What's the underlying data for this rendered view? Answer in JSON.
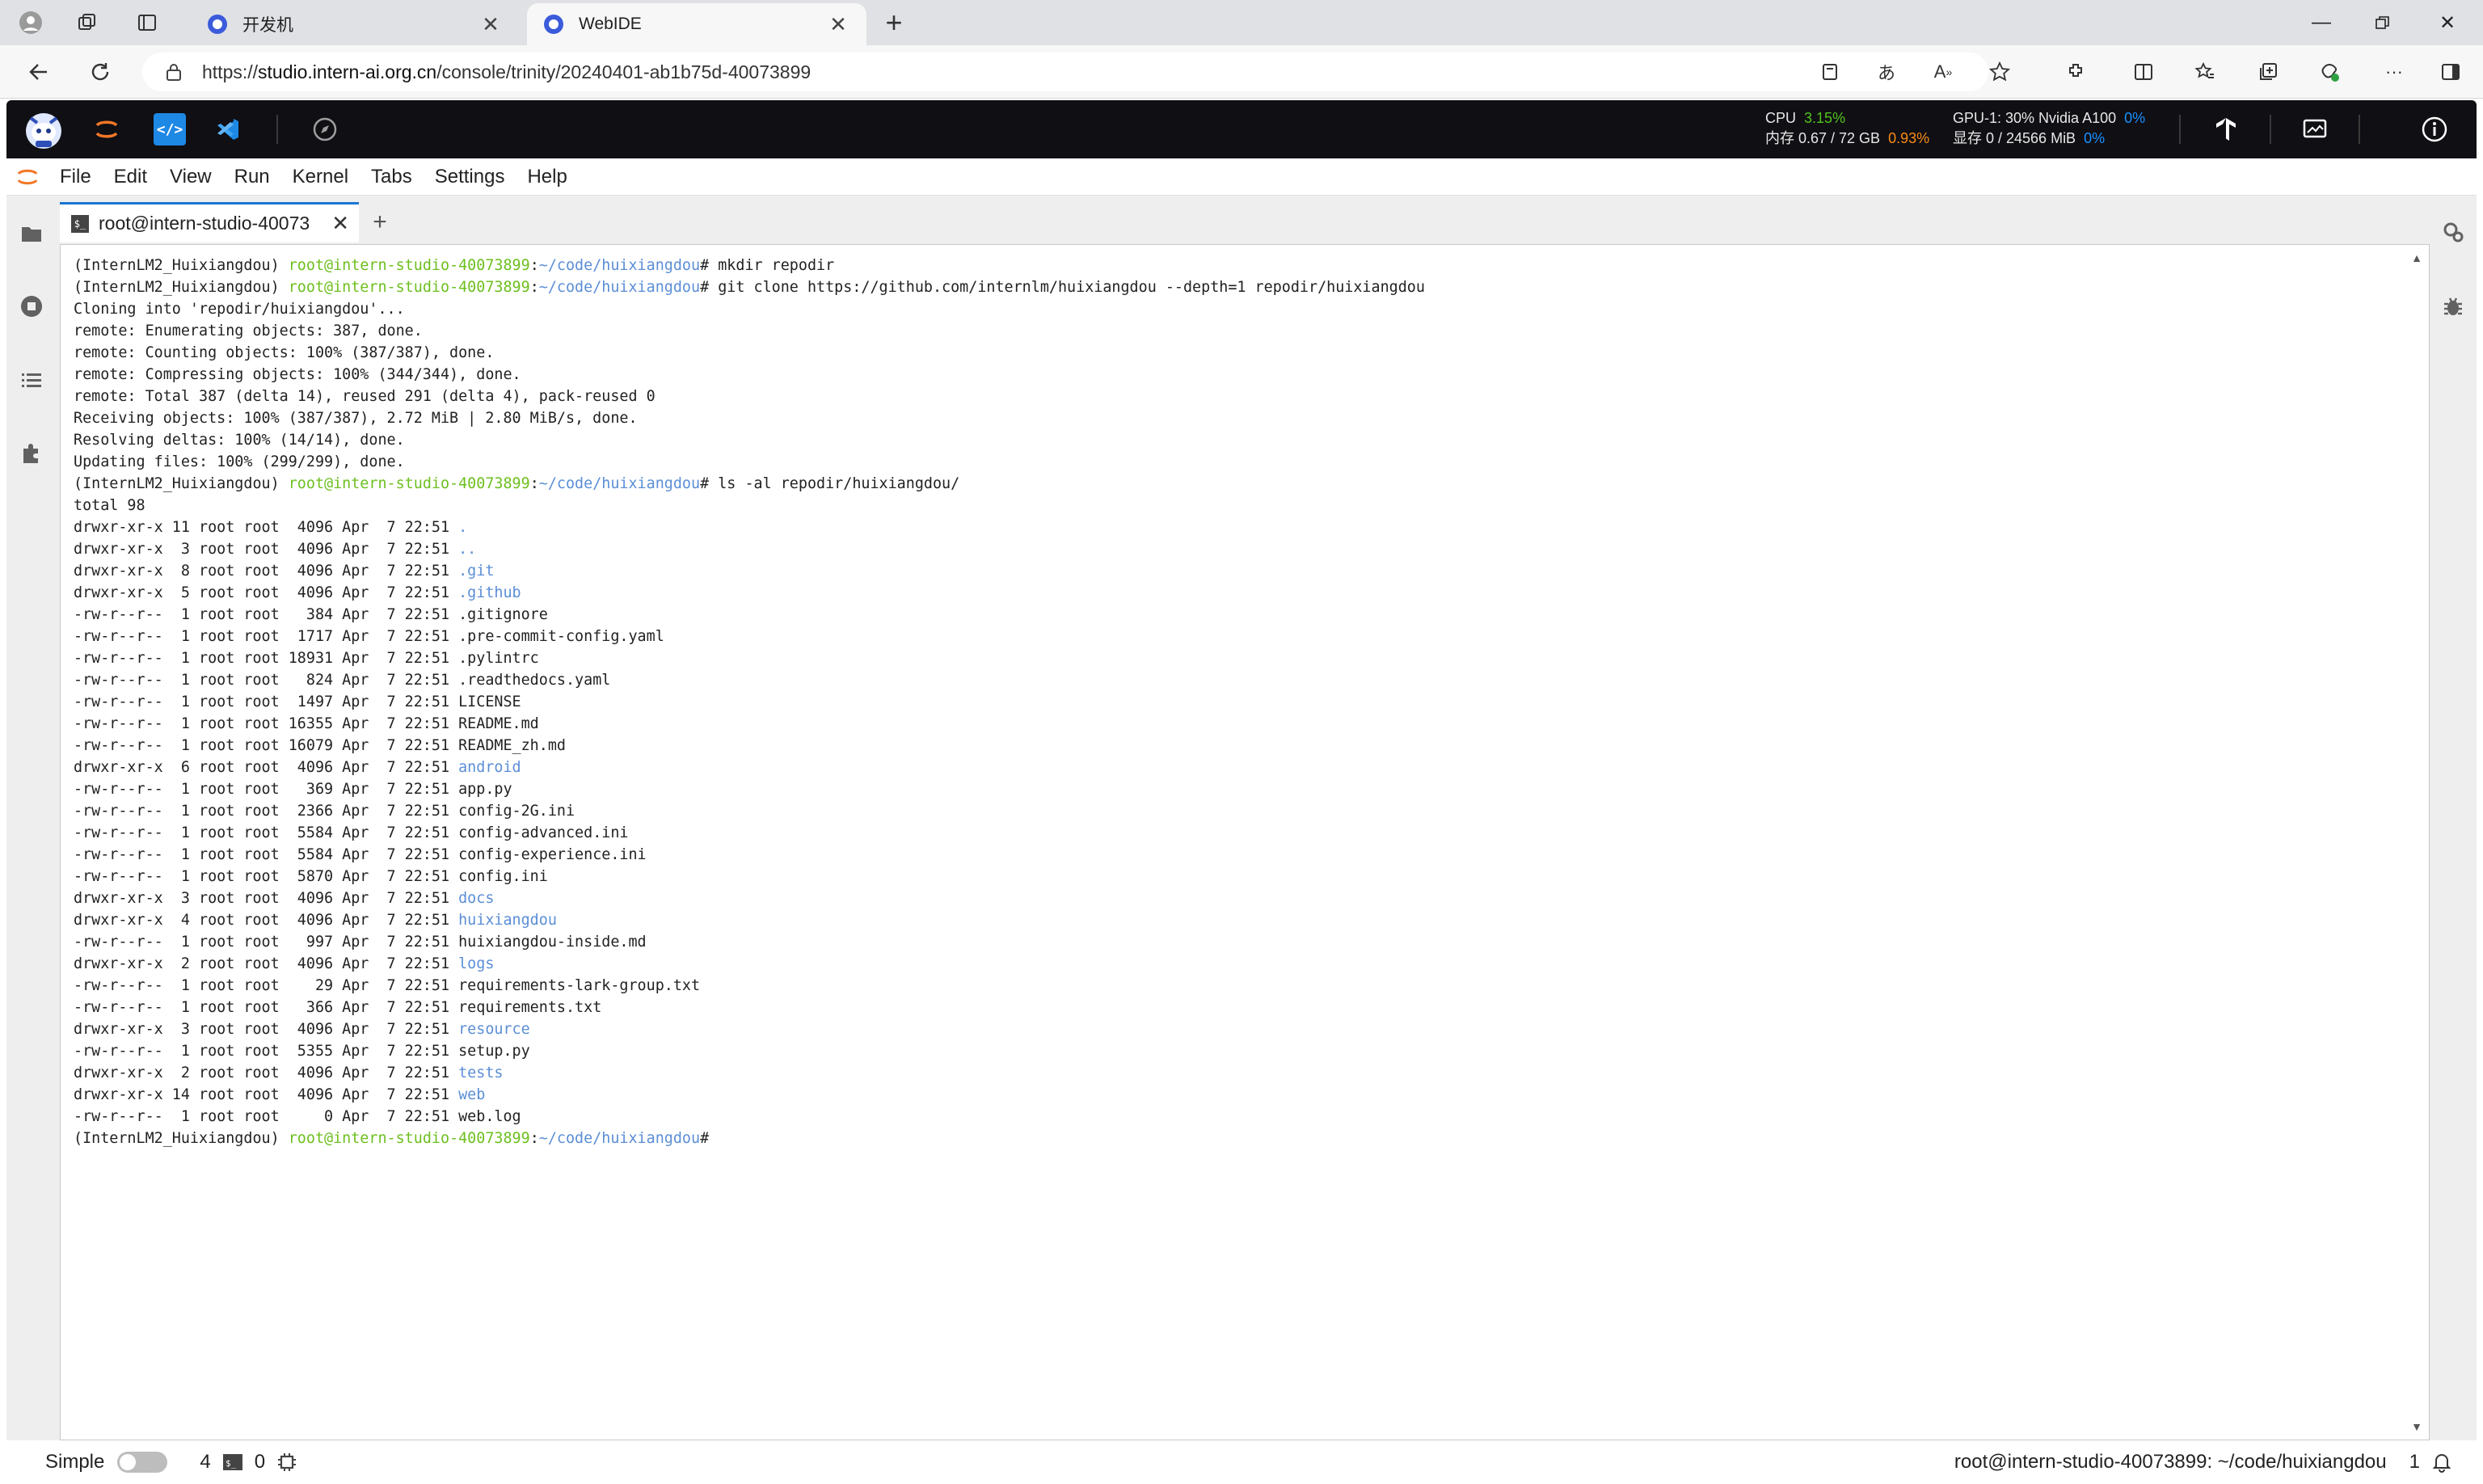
{
  "browser": {
    "tabs": [
      {
        "title": "开发机",
        "active": false
      },
      {
        "title": "WebIDE",
        "active": true
      }
    ],
    "url_prefix": "https://",
    "url_host": "studio.intern-ai.org.cn",
    "url_path": "/console/trinity/20240401-ab1b75d-40073899"
  },
  "ide": {
    "cpu_label": "CPU",
    "cpu_value": "3.15%",
    "mem_label": "内存 0.67 / 72 GB",
    "mem_value": "0.93%",
    "gpu_label": "GPU-1: 30% Nvidia A100",
    "gpu_value": "0%",
    "vram_label": "显存 0 / 24566 MiB",
    "vram_value": "0%"
  },
  "menu": [
    "File",
    "Edit",
    "View",
    "Run",
    "Kernel",
    "Tabs",
    "Settings",
    "Help"
  ],
  "terminal": {
    "tab_title": "root@intern-studio-40073",
    "prompt_env": "(InternLM2_Huixiangdou) ",
    "prompt_user": "root@intern-studio-40073899",
    "prompt_sep": ":",
    "prompt_path": "~/code/huixiangdou",
    "prompt_end": "# ",
    "commands": [
      "mkdir repodir",
      "git clone https://github.com/internlm/huixiangdou --depth=1 repodir/huixiangdou",
      "ls -al repodir/huixiangdou/"
    ],
    "clone_output": [
      "Cloning into 'repodir/huixiangdou'...",
      "remote: Enumerating objects: 387, done.",
      "remote: Counting objects: 100% (387/387), done.",
      "remote: Compressing objects: 100% (344/344), done.",
      "remote: Total 387 (delta 14), reused 291 (delta 4), pack-reused 0",
      "Receiving objects: 100% (387/387), 2.72 MiB | 2.80 MiB/s, done.",
      "Resolving deltas: 100% (14/14), done.",
      "Updating files: 100% (299/299), done."
    ],
    "ls_total": "total 98",
    "ls_entries": [
      {
        "meta": "drwxr-xr-x 11 root root  4096 Apr  7 22:51 ",
        "name": ".",
        "dir": true
      },
      {
        "meta": "drwxr-xr-x  3 root root  4096 Apr  7 22:51 ",
        "name": "..",
        "dir": true
      },
      {
        "meta": "drwxr-xr-x  8 root root  4096 Apr  7 22:51 ",
        "name": ".git",
        "dir": true
      },
      {
        "meta": "drwxr-xr-x  5 root root  4096 Apr  7 22:51 ",
        "name": ".github",
        "dir": true
      },
      {
        "meta": "-rw-r--r--  1 root root   384 Apr  7 22:51 ",
        "name": ".gitignore",
        "dir": false
      },
      {
        "meta": "-rw-r--r--  1 root root  1717 Apr  7 22:51 ",
        "name": ".pre-commit-config.yaml",
        "dir": false
      },
      {
        "meta": "-rw-r--r--  1 root root 18931 Apr  7 22:51 ",
        "name": ".pylintrc",
        "dir": false
      },
      {
        "meta": "-rw-r--r--  1 root root   824 Apr  7 22:51 ",
        "name": ".readthedocs.yaml",
        "dir": false
      },
      {
        "meta": "-rw-r--r--  1 root root  1497 Apr  7 22:51 ",
        "name": "LICENSE",
        "dir": false
      },
      {
        "meta": "-rw-r--r--  1 root root 16355 Apr  7 22:51 ",
        "name": "README.md",
        "dir": false
      },
      {
        "meta": "-rw-r--r--  1 root root 16079 Apr  7 22:51 ",
        "name": "README_zh.md",
        "dir": false
      },
      {
        "meta": "drwxr-xr-x  6 root root  4096 Apr  7 22:51 ",
        "name": "android",
        "dir": true
      },
      {
        "meta": "-rw-r--r--  1 root root   369 Apr  7 22:51 ",
        "name": "app.py",
        "dir": false
      },
      {
        "meta": "-rw-r--r--  1 root root  2366 Apr  7 22:51 ",
        "name": "config-2G.ini",
        "dir": false
      },
      {
        "meta": "-rw-r--r--  1 root root  5584 Apr  7 22:51 ",
        "name": "config-advanced.ini",
        "dir": false
      },
      {
        "meta": "-rw-r--r--  1 root root  5584 Apr  7 22:51 ",
        "name": "config-experience.ini",
        "dir": false
      },
      {
        "meta": "-rw-r--r--  1 root root  5870 Apr  7 22:51 ",
        "name": "config.ini",
        "dir": false
      },
      {
        "meta": "drwxr-xr-x  3 root root  4096 Apr  7 22:51 ",
        "name": "docs",
        "dir": true
      },
      {
        "meta": "drwxr-xr-x  4 root root  4096 Apr  7 22:51 ",
        "name": "huixiangdou",
        "dir": true
      },
      {
        "meta": "-rw-r--r--  1 root root   997 Apr  7 22:51 ",
        "name": "huixiangdou-inside.md",
        "dir": false
      },
      {
        "meta": "drwxr-xr-x  2 root root  4096 Apr  7 22:51 ",
        "name": "logs",
        "dir": true
      },
      {
        "meta": "-rw-r--r--  1 root root    29 Apr  7 22:51 ",
        "name": "requirements-lark-group.txt",
        "dir": false
      },
      {
        "meta": "-rw-r--r--  1 root root   366 Apr  7 22:51 ",
        "name": "requirements.txt",
        "dir": false
      },
      {
        "meta": "drwxr-xr-x  3 root root  4096 Apr  7 22:51 ",
        "name": "resource",
        "dir": true
      },
      {
        "meta": "-rw-r--r--  1 root root  5355 Apr  7 22:51 ",
        "name": "setup.py",
        "dir": false
      },
      {
        "meta": "drwxr-xr-x  2 root root  4096 Apr  7 22:51 ",
        "name": "tests",
        "dir": true
      },
      {
        "meta": "drwxr-xr-x 14 root root  4096 Apr  7 22:51 ",
        "name": "web",
        "dir": true
      },
      {
        "meta": "-rw-r--r--  1 root root     0 Apr  7 22:51 ",
        "name": "web.log",
        "dir": false
      }
    ]
  },
  "status": {
    "mode_label": "Simple",
    "kernels_count": "4",
    "terminals_count": "0",
    "right_text": "root@intern-studio-40073899: ~/code/huixiangdou",
    "notif_count": "1"
  },
  "colors": {
    "prompt_user": "#6dbf1f",
    "prompt_path": "#5b8ed6",
    "directory": "#5b8ed6",
    "ide_bar": "#0f0f14",
    "tab_accent": "#1976d2"
  }
}
